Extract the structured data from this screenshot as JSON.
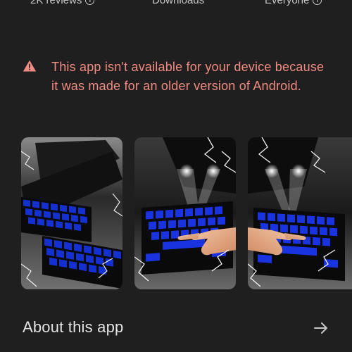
{
  "stats": {
    "reviews_label": "2K reviews",
    "downloads_label": "Downloads",
    "rating_label": "Everyone",
    "icon": "info-icon"
  },
  "warning": {
    "icon": "warning-triangle-icon",
    "message": "This app isn't available for your device because it was made for an older version of Android.",
    "color": "#f28b82"
  },
  "screenshots": {
    "items": [
      {
        "description_name": "keyboard-screenshot-1"
      },
      {
        "description_name": "keyboard-screenshot-2"
      },
      {
        "description_name": "keyboard-screenshot-3"
      }
    ],
    "accent_color": "#1a2fd6"
  },
  "about": {
    "title": "About this app",
    "icon": "arrow-right-icon"
  }
}
